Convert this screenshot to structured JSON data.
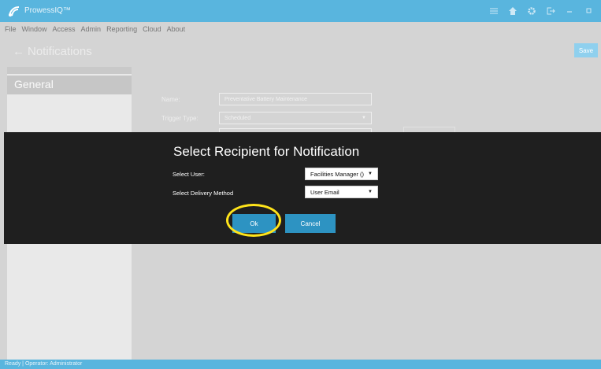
{
  "app": {
    "title": "ProwessIQ™"
  },
  "window_controls": [
    {
      "name": "menu-icon"
    },
    {
      "name": "home-icon"
    },
    {
      "name": "gear-icon"
    },
    {
      "name": "logout-icon"
    },
    {
      "name": "minimize-icon"
    },
    {
      "name": "maximize-icon"
    }
  ],
  "menubar": {
    "items": [
      "File",
      "Window",
      "Access",
      "Admin",
      "Reporting",
      "Cloud",
      "About"
    ]
  },
  "header": {
    "back_arrow": "←",
    "title": "Notifications",
    "save_label": "Save"
  },
  "sidebar": {
    "items": [
      {
        "label": "General"
      }
    ]
  },
  "form": {
    "name_label": "Name:",
    "name_value": "Preventative Battery Maintenance",
    "trigger_label": "Trigger Type:",
    "trigger_value": "Scheduled"
  },
  "modal": {
    "title": "Select Recipient for Notification",
    "user_label": "Select User:",
    "user_value": "Facilities Manager ()",
    "delivery_label": "Select Delivery Method",
    "delivery_value": "User Email",
    "ok_label": "Ok",
    "cancel_label": "Cancel"
  },
  "status": {
    "text": "Ready | Operator: Administrator"
  },
  "colors": {
    "accent": "#59b5de",
    "button": "#2d93c2",
    "modal_bg": "#1f1f1f",
    "highlight": "#ffe41a"
  }
}
